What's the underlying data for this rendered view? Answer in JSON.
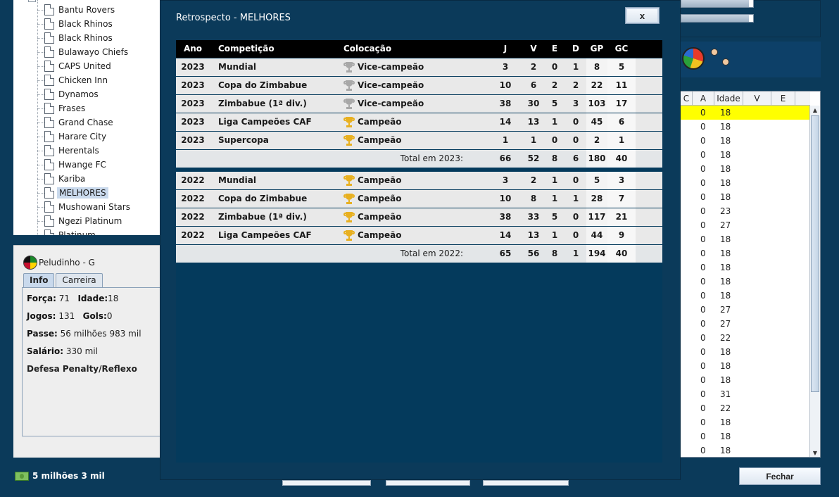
{
  "tree": {
    "items": [
      {
        "label": "Bantu Rovers"
      },
      {
        "label": "Black Rhinos"
      },
      {
        "label": "Black Rhinos"
      },
      {
        "label": "Bulawayo Chiefs"
      },
      {
        "label": "CAPS United"
      },
      {
        "label": "Chicken Inn"
      },
      {
        "label": "Dynamos"
      },
      {
        "label": "Frases"
      },
      {
        "label": "Grand Chase"
      },
      {
        "label": "Harare City"
      },
      {
        "label": "Herentals"
      },
      {
        "label": "Hwange FC"
      },
      {
        "label": "Kariba"
      },
      {
        "label": "MELHORES",
        "selected": true
      },
      {
        "label": "Mushowani Stars"
      },
      {
        "label": "Ngezi Platinum"
      },
      {
        "label": "Platinum"
      }
    ]
  },
  "player": {
    "name": "Peludinho - G",
    "tabs": [
      "Info",
      "Carreira"
    ],
    "forca_label": "Força:",
    "forca": "71",
    "idade_label": "Idade:",
    "idade": "18",
    "jogos_label": "Jogos:",
    "jogos": "131",
    "gols_label": "Gols:",
    "gols": "0",
    "passe_label": "Passe:",
    "passe": "56 milhões 983 mil",
    "salario_label": "Salário:",
    "salario": "330 mil",
    "skill": "Defesa Penalty/Reflexo"
  },
  "money": "5 milhões 3 mil",
  "fechar": "Fechar",
  "right_table": {
    "headers": [
      "C",
      "A",
      "Idade",
      "V",
      "E"
    ],
    "rows": [
      {
        "a": "0",
        "idade": "18",
        "highlight": true
      },
      {
        "a": "0",
        "idade": "18"
      },
      {
        "a": "0",
        "idade": "18"
      },
      {
        "a": "0",
        "idade": "18"
      },
      {
        "a": "0",
        "idade": "18"
      },
      {
        "a": "0",
        "idade": "18"
      },
      {
        "a": "0",
        "idade": "18"
      },
      {
        "a": "0",
        "idade": "23"
      },
      {
        "a": "0",
        "idade": "27"
      },
      {
        "a": "0",
        "idade": "18"
      },
      {
        "a": "0",
        "idade": "18"
      },
      {
        "a": "0",
        "idade": "18"
      },
      {
        "a": "0",
        "idade": "18"
      },
      {
        "a": "0",
        "idade": "18"
      },
      {
        "a": "0",
        "idade": "27"
      },
      {
        "a": "0",
        "idade": "27"
      },
      {
        "a": "0",
        "idade": "22"
      },
      {
        "a": "0",
        "idade": "18"
      },
      {
        "a": "0",
        "idade": "18"
      },
      {
        "a": "0",
        "idade": "18"
      },
      {
        "a": "0",
        "idade": "31"
      },
      {
        "a": "0",
        "idade": "22"
      },
      {
        "a": "0",
        "idade": "18"
      },
      {
        "a": "0",
        "idade": "18"
      },
      {
        "a": "0",
        "idade": "18"
      }
    ]
  },
  "dialog": {
    "title": "Retrospecto - MELHORES",
    "close": "x",
    "headers": {
      "ano": "Ano",
      "comp": "Competição",
      "col": "Colocação",
      "j": "J",
      "v": "V",
      "e": "E",
      "d": "D",
      "gp": "GP",
      "gc": "GC"
    },
    "groups": [
      {
        "rows": [
          {
            "ano": "2023",
            "comp": "Mundial",
            "col": "Vice-campeão",
            "trophy": "silver-trophy-icon",
            "j": "3",
            "v": "2",
            "e": "0",
            "d": "1",
            "gp": "8",
            "gc": "5"
          },
          {
            "ano": "2023",
            "comp": "Copa do Zimbabue",
            "col": "Vice-campeão",
            "trophy": "silver-trophy-icon",
            "j": "10",
            "v": "6",
            "e": "2",
            "d": "2",
            "gp": "22",
            "gc": "11"
          },
          {
            "ano": "2023",
            "comp": "Zimbabue (1ª div.)",
            "col": "Vice-campeão",
            "trophy": "silver-trophy-icon",
            "j": "38",
            "v": "30",
            "e": "5",
            "d": "3",
            "gp": "103",
            "gc": "17"
          },
          {
            "ano": "2023",
            "comp": "Liga Campeões CAF",
            "col": "Campeão",
            "trophy": "gold-trophy-icon",
            "j": "14",
            "v": "13",
            "e": "1",
            "d": "0",
            "gp": "45",
            "gc": "6"
          },
          {
            "ano": "2023",
            "comp": "Supercopa",
            "col": "Campeão",
            "trophy": "gold-trophy-icon",
            "j": "1",
            "v": "1",
            "e": "0",
            "d": "0",
            "gp": "2",
            "gc": "1"
          }
        ],
        "total": {
          "label": "Total em 2023:",
          "j": "66",
          "v": "52",
          "e": "8",
          "d": "6",
          "gp": "180",
          "gc": "40"
        }
      },
      {
        "rows": [
          {
            "ano": "2022",
            "comp": "Mundial",
            "col": "Campeão",
            "trophy": "gold-trophy-icon",
            "j": "3",
            "v": "2",
            "e": "1",
            "d": "0",
            "gp": "5",
            "gc": "3"
          },
          {
            "ano": "2022",
            "comp": "Copa do Zimbabue",
            "col": "Campeão",
            "trophy": "gold-trophy-icon",
            "j": "10",
            "v": "8",
            "e": "1",
            "d": "1",
            "gp": "28",
            "gc": "7"
          },
          {
            "ano": "2022",
            "comp": "Zimbabue (1ª div.)",
            "col": "Campeão",
            "trophy": "gold-trophy-icon",
            "j": "38",
            "v": "33",
            "e": "5",
            "d": "0",
            "gp": "117",
            "gc": "21"
          },
          {
            "ano": "2022",
            "comp": "Liga Campeões CAF",
            "col": "Campeão",
            "trophy": "gold-trophy-icon",
            "j": "14",
            "v": "13",
            "e": "1",
            "d": "0",
            "gp": "44",
            "gc": "9"
          }
        ],
        "total": {
          "label": "Total em 2022:",
          "j": "65",
          "v": "56",
          "e": "8",
          "d": "1",
          "gp": "194",
          "gc": "40"
        }
      }
    ],
    "colors": {
      "gold": "#e8b020",
      "silver": "#a8a8a8",
      "header_bg": "#000000",
      "panel_bg": "#043a5c"
    }
  }
}
